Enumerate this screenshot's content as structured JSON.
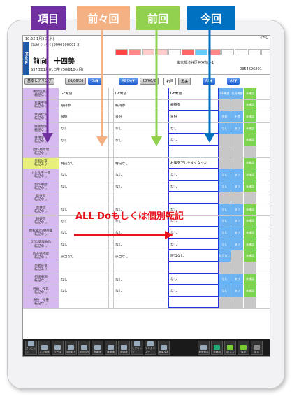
{
  "callouts": {
    "items_label": "項目",
    "prev2_label": "前々回",
    "prev_label": "前回",
    "current_label": "今回"
  },
  "colors": {
    "items": "#7030a0",
    "prev2": "#f4b183",
    "prev": "#92d050",
    "current": "#0070c0",
    "red": "#e8141a"
  },
  "status_bar": {
    "time": "10:52",
    "date": "1月5日(木)",
    "battery": "47%"
  },
  "header": {
    "menu": "Menu",
    "patient_id": "ﾏｴﾑｶｲ ｼﾞｭｳｼﾐ (9990100001-3)",
    "name": "前向　十四美",
    "birth": "S37年01月01日生 (58歳10ヶ月)",
    "address": "東京都渋谷区神宮前3-1",
    "phone": "0354696201"
  },
  "toolbar": {
    "section": "基本ヒアリング",
    "section_sub": "(転記なし/転記あり)",
    "prev2_date": "20/06/26",
    "do_btn": "Do▼",
    "all_do_btn": "All Do▼",
    "prev_date": "20/06/2",
    "first_visit": "初回",
    "revisit": "再来",
    "all_btn": "All▼",
    "all_btn2": "All▼"
  },
  "overlay_text": "ALL Doもしくは個別転記",
  "rows": [
    {
      "item": "後発医薬品\n(転記なし)",
      "prev2": "GE希望",
      "prev": "GE希望",
      "cur": "GE希望",
      "s1": "GE希望",
      "s2": "先発希望",
      "s3": "未確認"
    },
    {
      "item": "お薬手帳\n(転記なし)",
      "prev2": "紙持参",
      "prev": "紙持参",
      "cur": "紙持参",
      "s1": "",
      "s2": "",
      "s3": "未確認"
    },
    {
      "item": "体調状況\n(転記なし)",
      "prev2": "良好",
      "prev": "良好",
      "cur": "良好",
      "s1": "良好",
      "s2": "不良",
      "s3": "未確認"
    },
    {
      "item": "残薬情報\n(転記なし)",
      "prev2": "なし",
      "prev": "なし",
      "cur": "なし",
      "s1": "なし",
      "s2": "あり",
      "s3": "未確認"
    },
    {
      "item": "併用変化\n(転記なし)",
      "prev2": "なし",
      "prev": "なし",
      "cur": "なし",
      "s1": "",
      "s2": "",
      "s3": "未確認"
    },
    {
      "item": "副作用発現\n(転記なし)",
      "prev2": "",
      "prev": "",
      "cur": "",
      "s1": "",
      "s2": "",
      "s3": ""
    },
    {
      "item": "患者体質\n(転記あり)",
      "prev2": "特記なし",
      "prev": "特記なし",
      "cur": "お腹を下しやすくなった",
      "s1": "",
      "s2": "",
      "s3": "未確認",
      "hl": true
    },
    {
      "item": "アレルギー歴\n(転記なし)",
      "prev2": "なし",
      "prev": "なし",
      "cur": "なし",
      "s1": "なし",
      "s2": "あり",
      "s3": "未確認"
    },
    {
      "item": "副作用歴\n(転記なし)",
      "prev2": "なし",
      "prev": "なし",
      "cur": "なし",
      "s1": "なし",
      "s2": "あり",
      "s3": "未確認"
    },
    {
      "item": "既往歴\n(転記なし)",
      "prev2": "",
      "prev": "",
      "cur": "",
      "s1": "",
      "s2": "",
      "s3": ""
    },
    {
      "item": "合併症\n(転記なし)",
      "prev2": "なし",
      "prev": "なし",
      "cur": "なし",
      "s1": "なし",
      "s2": "あり",
      "s3": "未確認"
    },
    {
      "item": "嗜好品\n(転記なし)",
      "prev2": "なし",
      "prev": "なし",
      "cur": "なし",
      "s1": "なし",
      "s2": "あり",
      "s3": "未確認"
    },
    {
      "item": "他科受診/併用薬\n(転記なし)",
      "prev2": "なし",
      "prev": "なし",
      "cur": "なし",
      "s1": "なし",
      "s2": "あり",
      "s3": "未確認"
    },
    {
      "item": "OTC/健康食品\n(転記なし)",
      "prev2": "なし",
      "prev": "なし",
      "cur": "なし",
      "s1": "なし",
      "s2": "あり",
      "s3": "未確認"
    },
    {
      "item": "飲食物摂取\n(転記なし)",
      "prev2": "該当なし",
      "prev": "該当なし",
      "cur": "該当なし",
      "s1": "該当なし",
      "s2": "",
      "s3": "未確認"
    },
    {
      "item": "患者背景\n(転記あり)",
      "prev2": "",
      "prev": "",
      "cur": "",
      "s1": "",
      "s2": "",
      "s3": ""
    },
    {
      "item": "相談事項\n(転記なし)",
      "prev2": "なし",
      "prev": "なし",
      "cur": "なし",
      "s1": "なし",
      "s2": "あり",
      "s3": "未確認"
    },
    {
      "item": "妊娠・授乳\n(転記なし)",
      "prev2": "なし",
      "prev": "なし",
      "cur": "なし",
      "s1": "なし",
      "s2": "あり",
      "s3": "未確認"
    },
    {
      "item": "身長・体重\n(転記なし)",
      "prev2": "",
      "prev": "",
      "cur": "",
      "s1": "",
      "s2": "",
      "s3": ""
    }
  ],
  "bottom_buttons": [
    "さっと入力",
    "入力申請",
    "ツール",
    "今回処方",
    "前回処方",
    "指導歴",
    "検査値",
    "服薬歴",
    "ヒアリング",
    "モニタリング",
    "服薬文書",
    "",
    "",
    "履歴照会",
    "未確認",
    "QE入力",
    "保存",
    "戻る"
  ]
}
